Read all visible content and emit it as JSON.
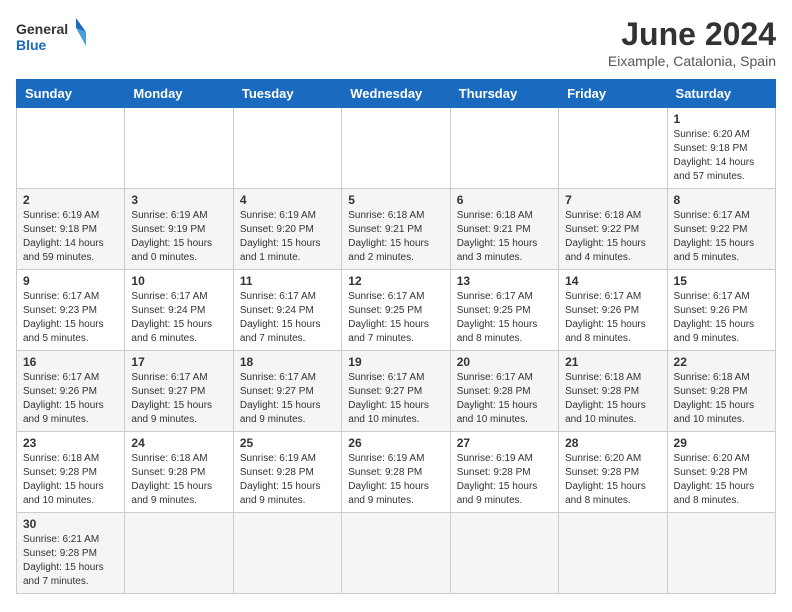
{
  "header": {
    "logo_general": "General",
    "logo_blue": "Blue",
    "month_title": "June 2024",
    "subtitle": "Eixample, Catalonia, Spain"
  },
  "weekdays": [
    "Sunday",
    "Monday",
    "Tuesday",
    "Wednesday",
    "Thursday",
    "Friday",
    "Saturday"
  ],
  "weeks": [
    [
      {
        "day": "",
        "info": ""
      },
      {
        "day": "",
        "info": ""
      },
      {
        "day": "",
        "info": ""
      },
      {
        "day": "",
        "info": ""
      },
      {
        "day": "",
        "info": ""
      },
      {
        "day": "",
        "info": ""
      },
      {
        "day": "1",
        "info": "Sunrise: 6:20 AM\nSunset: 9:18 PM\nDaylight: 14 hours and 57 minutes."
      }
    ],
    [
      {
        "day": "2",
        "info": "Sunrise: 6:19 AM\nSunset: 9:18 PM\nDaylight: 14 hours and 59 minutes."
      },
      {
        "day": "3",
        "info": "Sunrise: 6:19 AM\nSunset: 9:19 PM\nDaylight: 15 hours and 0 minutes."
      },
      {
        "day": "4",
        "info": "Sunrise: 6:19 AM\nSunset: 9:20 PM\nDaylight: 15 hours and 1 minute."
      },
      {
        "day": "5",
        "info": "Sunrise: 6:18 AM\nSunset: 9:21 PM\nDaylight: 15 hours and 2 minutes."
      },
      {
        "day": "6",
        "info": "Sunrise: 6:18 AM\nSunset: 9:21 PM\nDaylight: 15 hours and 3 minutes."
      },
      {
        "day": "7",
        "info": "Sunrise: 6:18 AM\nSunset: 9:22 PM\nDaylight: 15 hours and 4 minutes."
      },
      {
        "day": "8",
        "info": "Sunrise: 6:17 AM\nSunset: 9:22 PM\nDaylight: 15 hours and 5 minutes."
      }
    ],
    [
      {
        "day": "9",
        "info": "Sunrise: 6:17 AM\nSunset: 9:23 PM\nDaylight: 15 hours and 5 minutes."
      },
      {
        "day": "10",
        "info": "Sunrise: 6:17 AM\nSunset: 9:24 PM\nDaylight: 15 hours and 6 minutes."
      },
      {
        "day": "11",
        "info": "Sunrise: 6:17 AM\nSunset: 9:24 PM\nDaylight: 15 hours and 7 minutes."
      },
      {
        "day": "12",
        "info": "Sunrise: 6:17 AM\nSunset: 9:25 PM\nDaylight: 15 hours and 7 minutes."
      },
      {
        "day": "13",
        "info": "Sunrise: 6:17 AM\nSunset: 9:25 PM\nDaylight: 15 hours and 8 minutes."
      },
      {
        "day": "14",
        "info": "Sunrise: 6:17 AM\nSunset: 9:26 PM\nDaylight: 15 hours and 8 minutes."
      },
      {
        "day": "15",
        "info": "Sunrise: 6:17 AM\nSunset: 9:26 PM\nDaylight: 15 hours and 9 minutes."
      }
    ],
    [
      {
        "day": "16",
        "info": "Sunrise: 6:17 AM\nSunset: 9:26 PM\nDaylight: 15 hours and 9 minutes."
      },
      {
        "day": "17",
        "info": "Sunrise: 6:17 AM\nSunset: 9:27 PM\nDaylight: 15 hours and 9 minutes."
      },
      {
        "day": "18",
        "info": "Sunrise: 6:17 AM\nSunset: 9:27 PM\nDaylight: 15 hours and 9 minutes."
      },
      {
        "day": "19",
        "info": "Sunrise: 6:17 AM\nSunset: 9:27 PM\nDaylight: 15 hours and 10 minutes."
      },
      {
        "day": "20",
        "info": "Sunrise: 6:17 AM\nSunset: 9:28 PM\nDaylight: 15 hours and 10 minutes."
      },
      {
        "day": "21",
        "info": "Sunrise: 6:18 AM\nSunset: 9:28 PM\nDaylight: 15 hours and 10 minutes."
      },
      {
        "day": "22",
        "info": "Sunrise: 6:18 AM\nSunset: 9:28 PM\nDaylight: 15 hours and 10 minutes."
      }
    ],
    [
      {
        "day": "23",
        "info": "Sunrise: 6:18 AM\nSunset: 9:28 PM\nDaylight: 15 hours and 10 minutes."
      },
      {
        "day": "24",
        "info": "Sunrise: 6:18 AM\nSunset: 9:28 PM\nDaylight: 15 hours and 9 minutes."
      },
      {
        "day": "25",
        "info": "Sunrise: 6:19 AM\nSunset: 9:28 PM\nDaylight: 15 hours and 9 minutes."
      },
      {
        "day": "26",
        "info": "Sunrise: 6:19 AM\nSunset: 9:28 PM\nDaylight: 15 hours and 9 minutes."
      },
      {
        "day": "27",
        "info": "Sunrise: 6:19 AM\nSunset: 9:28 PM\nDaylight: 15 hours and 9 minutes."
      },
      {
        "day": "28",
        "info": "Sunrise: 6:20 AM\nSunset: 9:28 PM\nDaylight: 15 hours and 8 minutes."
      },
      {
        "day": "29",
        "info": "Sunrise: 6:20 AM\nSunset: 9:28 PM\nDaylight: 15 hours and 8 minutes."
      }
    ],
    [
      {
        "day": "30",
        "info": "Sunrise: 6:21 AM\nSunset: 9:28 PM\nDaylight: 15 hours and 7 minutes."
      },
      {
        "day": "",
        "info": ""
      },
      {
        "day": "",
        "info": ""
      },
      {
        "day": "",
        "info": ""
      },
      {
        "day": "",
        "info": ""
      },
      {
        "day": "",
        "info": ""
      },
      {
        "day": "",
        "info": ""
      }
    ]
  ]
}
